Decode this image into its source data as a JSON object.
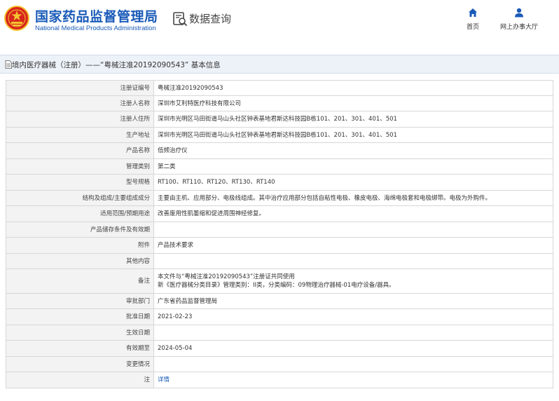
{
  "header": {
    "title_cn": "国家药品监督管理局",
    "title_en": "National Medical Products Administration",
    "query_label": "数据查询",
    "nav": [
      {
        "label": "首页",
        "icon": "home-icon"
      },
      {
        "label": "网上办事大厅",
        "icon": "user-icon"
      }
    ]
  },
  "titlebar": {
    "text": "境内医疗器械（注册）——“粤械注准20192090543” 基本信息"
  },
  "rows": [
    {
      "label": "注册证编号",
      "value": "粤械注准20192090543"
    },
    {
      "label": "注册人名称",
      "value": "深圳市艾利特医疗科技有限公司"
    },
    {
      "label": "注册人住所",
      "value": "深圳市光明区马田街道马山头社区钟表基地君斯达科技园B栋101、201、301、401、501"
    },
    {
      "label": "生产地址",
      "value": "深圳市光明区马田街道马山头社区钟表基地君斯达科技园B栋101、201、301、401、501"
    },
    {
      "label": "产品名称",
      "value": "低频治疗仪"
    },
    {
      "label": "管理类别",
      "value": "第二类"
    },
    {
      "label": "型号规格",
      "value": "RT100、RT110、RT120、RT130、RT140"
    },
    {
      "label": "结构及组成/主要组成成分",
      "value": "主要由主机、应用部分、电极线组成。其中治疗应用部分包括自粘性电极、橡皮电极、海绵电极套和电极绑带。电极为外购件。"
    },
    {
      "label": "适用范围/预期用途",
      "value": "改善废用性肌萎缩和促进周围神经修复。"
    },
    {
      "label": "产品储存条件及有效期",
      "value": ""
    },
    {
      "label": "附件",
      "value": "产品技术要求"
    },
    {
      "label": "其他内容",
      "value": ""
    },
    {
      "label": "备注",
      "value": "本文件与“粤械注准20192090543”注册证共同使用",
      "value2": "新《医疗器械分类目录》管理类别：II类，分类编码：09物理治疗器械-01电疗设备/器具。"
    },
    {
      "label": "审批部门",
      "value": "广东省药品监督管理局"
    },
    {
      "label": "批准日期",
      "value": "2021-02-23"
    },
    {
      "label": "生效日期",
      "value": ""
    },
    {
      "label": "有效期至",
      "value": "2024-05-04"
    },
    {
      "label": "变更情况",
      "value": ""
    },
    {
      "label": "注",
      "value": "详情",
      "link": true
    }
  ],
  "colors": {
    "brand_blue": "#1a5bb8",
    "emblem_red": "#d8261c",
    "emblem_gold": "#f4c430"
  }
}
